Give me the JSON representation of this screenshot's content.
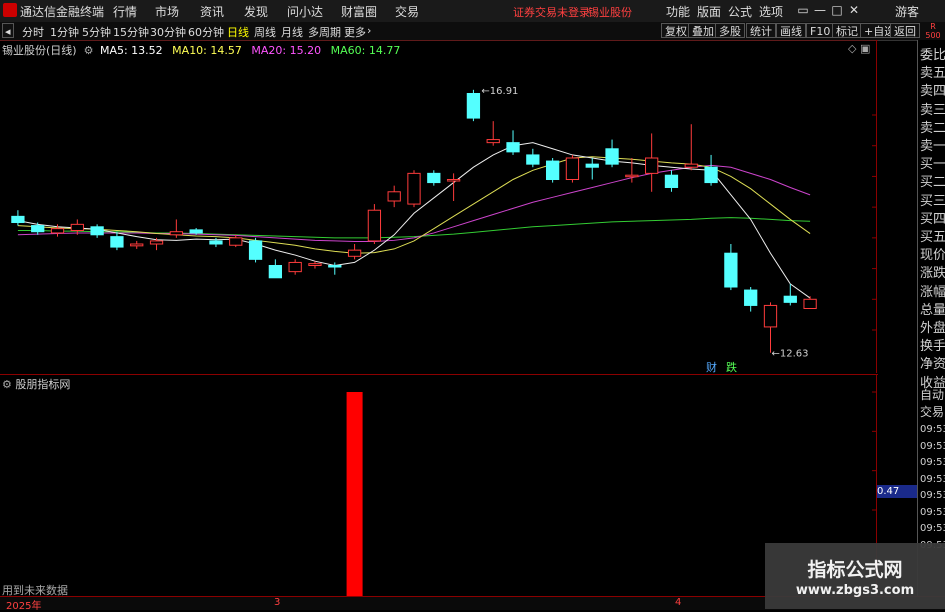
{
  "titlebar": {
    "app_title": "通达信金融终端",
    "menus": [
      "行情",
      "市场",
      "资讯",
      "发现",
      "问小达",
      "财富圈",
      "交易"
    ],
    "notice": "证券交易未登录",
    "stock_name": "锡业股份",
    "right_menus": [
      "功能",
      "版面",
      "公式",
      "选项"
    ],
    "guest": "游客",
    "win_buttons": [
      "▭",
      "—",
      "□",
      "✕"
    ]
  },
  "periodbar": {
    "back": "◂",
    "periods": [
      "分时",
      "1分钟",
      "5分钟",
      "15分钟",
      "30分钟",
      "60分钟",
      "日线",
      "周线",
      "月线",
      "多周期",
      "更多"
    ],
    "active": "日线",
    "tools": [
      "复权",
      "叠加",
      "多股",
      "统计",
      "画线",
      "F10",
      "标记",
      "+自选",
      "返回"
    ]
  },
  "chart": {
    "stock_label": "锡业股份(日线)",
    "ma": [
      {
        "label": "MA5: 13.52",
        "color": "#ffffff"
      },
      {
        "label": "MA10: 14.57",
        "color": "#ffff55"
      },
      {
        "label": "MA20: 15.20",
        "color": "#ff55ff"
      },
      {
        "label": "MA60: 14.77",
        "color": "#55ff55"
      }
    ],
    "y_ticks": [
      "16.50",
      "16.00",
      "15.50",
      "15.00",
      "14.50",
      "14.00",
      "13.50",
      "13.00"
    ],
    "high_label": "16.91",
    "low_label": "12.63",
    "tag_cai": "财",
    "tag_die": "跌",
    "corner_icons": "◇ ▣"
  },
  "chart_data": {
    "type": "candlestick",
    "series_ma": [
      "MA5",
      "MA10",
      "MA20",
      "MA60"
    ],
    "ylim": [
      12.5,
      17.0
    ],
    "y_ticks": [
      13.0,
      13.5,
      14.0,
      14.5,
      15.0,
      15.5,
      16.0,
      16.5
    ],
    "candles": [
      {
        "o": 14.85,
        "c": 14.75,
        "h": 14.95,
        "l": 14.7
      },
      {
        "o": 14.7,
        "c": 14.6,
        "h": 14.75,
        "l": 14.55
      },
      {
        "o": 14.58,
        "c": 14.65,
        "h": 14.72,
        "l": 14.52
      },
      {
        "o": 14.62,
        "c": 14.72,
        "h": 14.8,
        "l": 14.55
      },
      {
        "o": 14.68,
        "c": 14.55,
        "h": 14.72,
        "l": 14.5
      },
      {
        "o": 14.52,
        "c": 14.35,
        "h": 14.6,
        "l": 14.3
      },
      {
        "o": 14.37,
        "c": 14.4,
        "h": 14.45,
        "l": 14.32
      },
      {
        "o": 14.4,
        "c": 14.45,
        "h": 14.5,
        "l": 14.3
      },
      {
        "o": 14.55,
        "c": 14.6,
        "h": 14.8,
        "l": 14.5
      },
      {
        "o": 14.63,
        "c": 14.58,
        "h": 14.66,
        "l": 14.55
      },
      {
        "o": 14.45,
        "c": 14.4,
        "h": 14.5,
        "l": 14.35
      },
      {
        "o": 14.38,
        "c": 14.5,
        "h": 14.55,
        "l": 14.35
      },
      {
        "o": 14.45,
        "c": 14.15,
        "h": 14.5,
        "l": 14.1
      },
      {
        "o": 14.05,
        "c": 13.85,
        "h": 14.15,
        "l": 13.85
      },
      {
        "o": 13.95,
        "c": 14.1,
        "h": 14.15,
        "l": 13.9
      },
      {
        "o": 14.05,
        "c": 14.08,
        "h": 14.12,
        "l": 14.0
      },
      {
        "o": 14.05,
        "c": 14.03,
        "h": 14.1,
        "l": 13.9
      },
      {
        "o": 14.2,
        "c": 14.3,
        "h": 14.4,
        "l": 14.15
      },
      {
        "o": 14.45,
        "c": 14.95,
        "h": 15.05,
        "l": 14.4
      },
      {
        "o": 15.1,
        "c": 15.25,
        "h": 15.35,
        "l": 15.0
      },
      {
        "o": 15.05,
        "c": 15.55,
        "h": 15.6,
        "l": 15.0
      },
      {
        "o": 15.55,
        "c": 15.4,
        "h": 15.6,
        "l": 15.35
      },
      {
        "o": 15.45,
        "c": 15.45,
        "h": 15.55,
        "l": 15.1
      },
      {
        "o": 16.85,
        "c": 16.45,
        "h": 16.91,
        "l": 16.4
      },
      {
        "o": 16.05,
        "c": 16.1,
        "h": 16.4,
        "l": 16.0
      },
      {
        "o": 16.05,
        "c": 15.9,
        "h": 16.25,
        "l": 15.85
      },
      {
        "o": 15.85,
        "c": 15.7,
        "h": 15.95,
        "l": 15.65
      },
      {
        "o": 15.75,
        "c": 15.45,
        "h": 15.8,
        "l": 15.4
      },
      {
        "o": 15.45,
        "c": 15.8,
        "h": 15.85,
        "l": 15.4
      },
      {
        "o": 15.7,
        "c": 15.65,
        "h": 15.8,
        "l": 15.45
      },
      {
        "o": 15.95,
        "c": 15.7,
        "h": 16.1,
        "l": 15.65
      },
      {
        "o": 15.5,
        "c": 15.52,
        "h": 15.8,
        "l": 15.4
      },
      {
        "o": 15.55,
        "c": 15.8,
        "h": 16.2,
        "l": 15.25
      },
      {
        "o": 15.52,
        "c": 15.32,
        "h": 15.6,
        "l": 15.25
      },
      {
        "o": 15.65,
        "c": 15.7,
        "h": 16.35,
        "l": 15.6
      },
      {
        "o": 15.65,
        "c": 15.4,
        "h": 15.85,
        "l": 15.35
      },
      {
        "o": 14.25,
        "c": 13.7,
        "h": 14.4,
        "l": 13.65
      },
      {
        "o": 13.65,
        "c": 13.4,
        "h": 13.7,
        "l": 13.3
      },
      {
        "o": 13.05,
        "c": 13.4,
        "h": 13.45,
        "l": 12.63
      },
      {
        "o": 13.55,
        "c": 13.45,
        "h": 13.75,
        "l": 13.4
      },
      {
        "o": 13.35,
        "c": 13.5,
        "h": 13.55,
        "l": 13.35
      }
    ],
    "ma5": [
      14.78,
      14.72,
      14.68,
      14.66,
      14.64,
      14.58,
      14.52,
      14.47,
      14.46,
      14.48,
      14.47,
      14.48,
      14.4,
      14.3,
      14.22,
      14.12,
      14.05,
      14.1,
      14.3,
      14.55,
      14.9,
      15.15,
      15.4,
      15.65,
      15.85,
      16.0,
      16.05,
      15.95,
      15.85,
      15.8,
      15.75,
      15.72,
      15.68,
      15.65,
      15.62,
      15.6,
      15.2,
      14.8,
      14.25,
      13.75,
      13.52
    ],
    "ma10": [
      14.7,
      14.68,
      14.66,
      14.65,
      14.64,
      14.62,
      14.6,
      14.57,
      14.55,
      14.53,
      14.52,
      14.5,
      14.46,
      14.42,
      14.38,
      14.32,
      14.28,
      14.25,
      14.26,
      14.32,
      14.45,
      14.65,
      14.85,
      15.05,
      15.25,
      15.45,
      15.6,
      15.7,
      15.8,
      15.82,
      15.8,
      15.78,
      15.75,
      15.72,
      15.7,
      15.65,
      15.5,
      15.3,
      15.05,
      14.8,
      14.57
    ],
    "ma20": [
      14.55,
      14.56,
      14.57,
      14.58,
      14.58,
      14.58,
      14.58,
      14.57,
      14.57,
      14.56,
      14.55,
      14.54,
      14.52,
      14.5,
      14.48,
      14.46,
      14.45,
      14.44,
      14.44,
      14.46,
      14.5,
      14.58,
      14.68,
      14.78,
      14.88,
      14.98,
      15.08,
      15.16,
      15.24,
      15.32,
      15.4,
      15.48,
      15.55,
      15.6,
      15.65,
      15.68,
      15.65,
      15.55,
      15.45,
      15.32,
      15.2
    ],
    "ma60": [
      14.62,
      14.62,
      14.61,
      14.61,
      14.6,
      14.6,
      14.59,
      14.58,
      14.58,
      14.57,
      14.56,
      14.55,
      14.54,
      14.53,
      14.52,
      14.51,
      14.5,
      14.5,
      14.5,
      14.51,
      14.52,
      14.54,
      14.56,
      14.59,
      14.62,
      14.65,
      14.68,
      14.7,
      14.72,
      14.74,
      14.76,
      14.77,
      14.78,
      14.79,
      14.8,
      14.82,
      14.83,
      14.82,
      14.8,
      14.78,
      14.77
    ]
  },
  "subchart": {
    "title": "股朋指标网",
    "y_ticks": [
      "1.00",
      "0.80",
      "0.60",
      "0.40"
    ],
    "cursor_value": "0.47",
    "note": "用到未来数据",
    "bar_value": 1.0,
    "bar_index": 17
  },
  "xaxis": {
    "labels": [
      "2025年",
      "3",
      "4"
    ]
  },
  "sidepanel": {
    "badge_top": "R",
    "badge_bot": "500",
    "items": [
      "委比",
      "卖五",
      "卖四",
      "卖三",
      "卖二",
      "卖一",
      "买一",
      "买二",
      "买三",
      "买四",
      "买五",
      "现价",
      "涨跌",
      "涨幅",
      "总量",
      "外盘",
      "换手",
      "净资",
      "收益"
    ],
    "auto": "自动",
    "trade": "交易",
    "times": [
      "09:53",
      "09:53",
      "09:53",
      "09:53",
      "09:53",
      "09:53",
      "09:53",
      "09:53"
    ]
  },
  "watermark": {
    "title": "指标公式网",
    "url": "www.zbgs3.com"
  }
}
